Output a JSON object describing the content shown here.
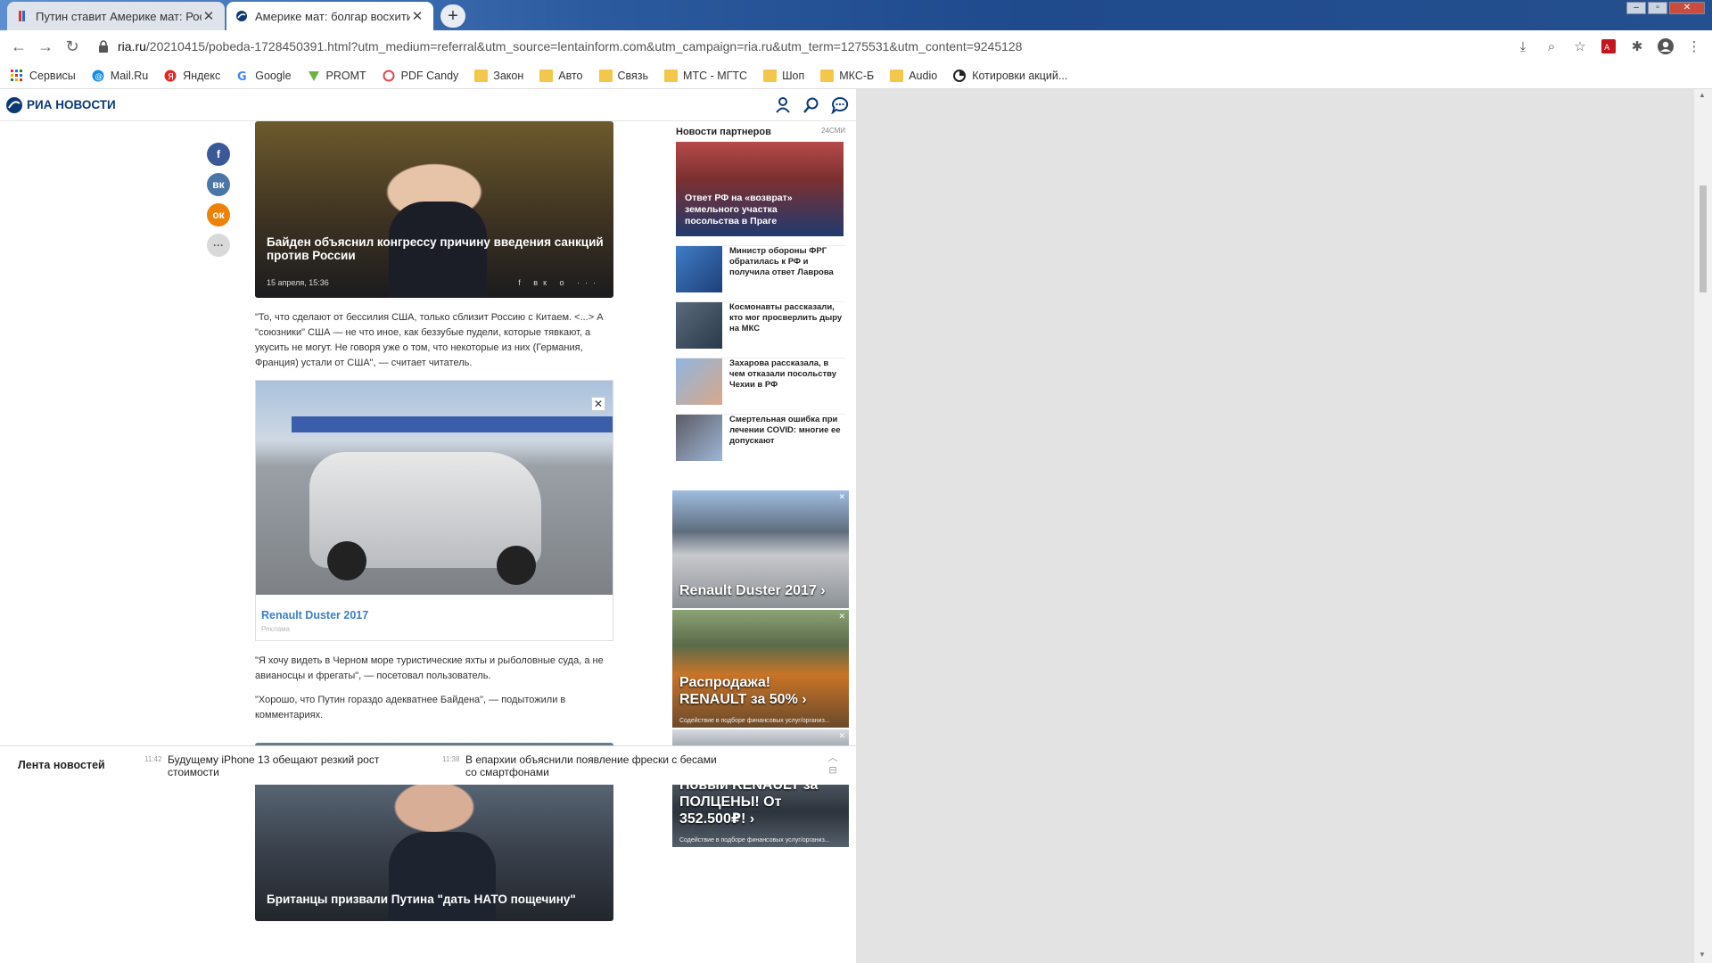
{
  "browser": {
    "tabs": [
      {
        "title": "Путин ставит Америке мат: Рос",
        "active": false
      },
      {
        "title": "Америке мат: болгар восхитила",
        "active": true
      }
    ],
    "url_host": "ria.ru",
    "url_rest": "/20210415/pobeda-1728450391.html?utm_medium=referral&utm_source=lentainform.com&utm_campaign=ria.ru&utm_term=1275531&utm_content=9245128",
    "bookmarks": [
      "Сервисы",
      "Mail.Ru",
      "Яндекс",
      "Google",
      "PROMT",
      "PDF Candy",
      "Закон",
      "Авто",
      "Связь",
      "МТС - МГТС",
      "Шоп",
      "МКС-Б",
      "Audio",
      "Котировки акций..."
    ]
  },
  "site": {
    "logo": "РИА НОВОСТИ"
  },
  "article": {
    "card1_title": "Байден объяснил конгрессу причину введения санкций против России",
    "card1_date": "15 апреля, 15:36",
    "para1": "\"То, что сделают от бессилия США, только сблизит Россию с Китаем. <...> А \"союзники\" США — не что иное, как беззубые пудели, которые тявкают, а укусить не могут. Не говоря уже о том, что некоторые из них (Германия, Франция) устали от США\", — считает читатель.",
    "ad_link": "Renault Duster 2017",
    "ad_tag": "Реклама",
    "para2": "\"Я хочу видеть в Черном море туристические яхты и рыболовные суда, а не авианосцы и фрегаты\", — посетовал пользователь.",
    "para3": "\"Хорошо, что Путин гораздо адекватнее Байдена\", — подытожили в комментариях.",
    "card2_title": "Британцы призвали Путина \"дать НАТО пощечину\""
  },
  "partners": {
    "heading": "Новости партнеров",
    "source": "24СМИ",
    "main_title": "Ответ РФ на «возврат» земельного участка посольства в Праге",
    "items": [
      "Министр обороны ФРГ обратилась к РФ и получила ответ Лаврова",
      "Космонавты рассказали, кто мог просверлить дыру на МКС",
      "Захарова рассказала, в чем отказали посольству Чехии в РФ",
      "Смертельная ошибка при лечении COVID: многие ее допускают"
    ]
  },
  "ads_right": [
    {
      "title": "Renault Duster 2017 ›",
      "small": ""
    },
    {
      "title": "Распродажа! RENAULT за 50% ›",
      "small": "Содействие в подборе финансовых услуг/организ..."
    },
    {
      "title": "Новый RENAULT за ПОЛЦЕНЫ! От 352.500₽! ›",
      "small": "Содействие в подборе финансовых услуг/организ..."
    }
  ],
  "newsbar": {
    "title": "Лента новостей",
    "items": [
      {
        "time": "11:42",
        "text": "Будущему iPhone 13 обещают резкий рост стоимости"
      },
      {
        "time": "11:38",
        "text": "В епархии объяснили появление фрески с бесами со смартфонами"
      }
    ]
  }
}
